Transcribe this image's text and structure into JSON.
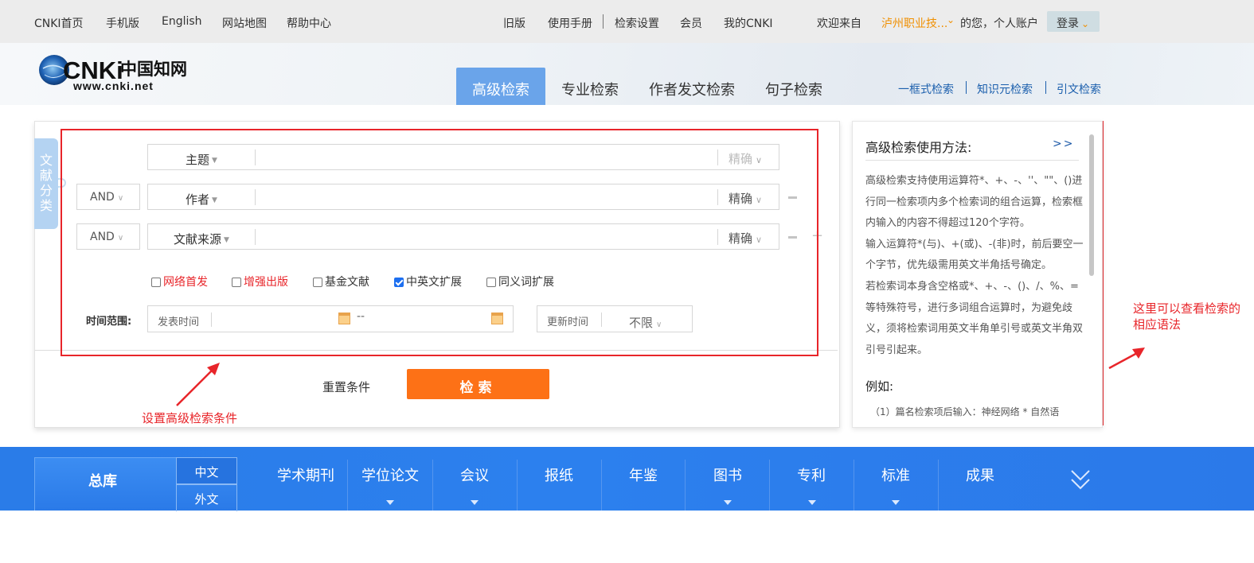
{
  "topnav": {
    "left": [
      "CNKI首页",
      "手机版",
      "English",
      "网站地图",
      "帮助中心"
    ],
    "right": [
      "旧版",
      "使用手册",
      "检索设置",
      "会员",
      "我的CNKI"
    ],
    "welcome": "欢迎来自",
    "institution": "泸州职业技...",
    "account_suffix": "的您，个人账户",
    "login": "登录"
  },
  "logo": {
    "brand": "CNKi",
    "cn": "中国知网",
    "url_text": "www.cnki.net"
  },
  "tabs": [
    "高级检索",
    "专业检索",
    "作者发文检索",
    "句子检索"
  ],
  "right_links": [
    "一框式检索",
    "知识元检索",
    "引文检索"
  ],
  "sidetab": "文献分类",
  "search_rows": [
    {
      "field": "主题",
      "precision": "精确"
    },
    {
      "op": "AND",
      "field": "作者",
      "precision": "精确"
    },
    {
      "op": "AND",
      "field": "文献来源",
      "precision": "精确"
    }
  ],
  "checkboxes": [
    {
      "label": "网络首发",
      "checked": false,
      "red": true
    },
    {
      "label": "增强出版",
      "checked": false,
      "red": true
    },
    {
      "label": "基金文献",
      "checked": false,
      "red": false
    },
    {
      "label": "中英文扩展",
      "checked": true,
      "red": false
    },
    {
      "label": "同义词扩展",
      "checked": false,
      "red": false
    }
  ],
  "time": {
    "label": "时间范围:",
    "publish": "发表时间",
    "dash": "--",
    "update": "更新时间",
    "update_value": "不限"
  },
  "actions": {
    "reset": "重置条件",
    "search": "检索"
  },
  "annotations": {
    "left": "设置高级检索条件",
    "right": "这里可以查看检索的相应语法"
  },
  "help": {
    "title": "高级检索使用方法:",
    "more": ">>",
    "paragraphs": [
      "高级检索支持使用运算符*、+、-、''、\"\"、()进行同一检索项内多个检索词的组合运算，检索框内输入的内容不得超过120个字符。",
      "输入运算符*(与)、+(或)、-(非)时，前后要空一个字节，优先级需用英文半角括号确定。",
      "若检索词本身含空格或*、+、-、()、/、%、=等特殊符号，进行多词组合运算时，为避免歧义，须将检索词用英文半角单引号或英文半角双引号引起来。"
    ],
    "example_title": "例如:",
    "example_1": "（1）篇名检索项后输入：神经网络 * 自然语"
  },
  "categories": {
    "main": "总库",
    "languages": [
      "中文",
      "外文"
    ],
    "items": [
      "学术期刊",
      "学位论文",
      "会议",
      "报纸",
      "年鉴",
      "图书",
      "专利",
      "标准",
      "成果"
    ]
  },
  "colors": {
    "accent": "#fd7116",
    "tab_active": "#6aa4ea",
    "category_bar": "#2b7ce8",
    "annotation": "#e8252a"
  }
}
